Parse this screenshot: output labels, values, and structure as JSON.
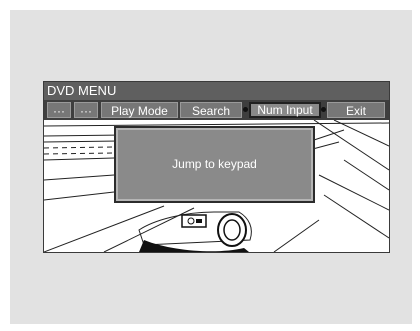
{
  "window": {
    "title": "DVD MENU"
  },
  "menu": {
    "items": [
      {
        "label": "···"
      },
      {
        "label": "···"
      },
      {
        "label": "Play Mode"
      },
      {
        "label": "Search"
      },
      {
        "label": "Num Input",
        "selected": true
      },
      {
        "label": "Exit"
      }
    ]
  },
  "dialog": {
    "message": "Jump to  keypad"
  },
  "colors": {
    "panel": "#e2e2e2",
    "titlebar": "#5f5f5f",
    "button": "#777777",
    "dialog": "#8a8a8a"
  }
}
